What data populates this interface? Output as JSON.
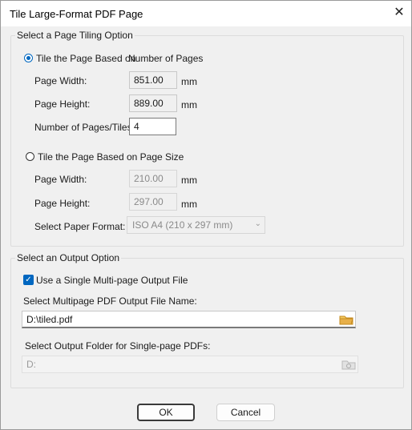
{
  "window": {
    "title": "Tile Large-Format PDF Page",
    "close_glyph": "✕"
  },
  "tiling": {
    "legend": "Select a Page Tiling Option",
    "by_pages": {
      "label": "Tile the Page Based on",
      "suffix": "Number of Pages",
      "selected": true,
      "width_label": "Page Width:",
      "width_value": "851.00",
      "width_unit": "mm",
      "height_label": "Page Height:",
      "height_value": "889.00",
      "height_unit": "mm",
      "tiles_label": "Number of Pages/Tiles:",
      "tiles_value": "4"
    },
    "by_size": {
      "label": "Tile the Page Based on Page Size",
      "selected": false,
      "width_label": "Page Width:",
      "width_value": "210.00",
      "width_unit": "mm",
      "height_label": "Page Height:",
      "height_value": "297.00",
      "height_unit": "mm",
      "format_label": "Select Paper Format:",
      "format_value": "ISO A4 (210 x 297 mm)"
    }
  },
  "output": {
    "legend": "Select an Output Option",
    "single_file": {
      "label": "Use a Single Multi-page Output File",
      "checked": true
    },
    "multipage_label": "Select Multipage PDF Output File Name:",
    "multipage_value": "D:\\tiled.pdf",
    "folder_label": "Select Output Folder for Single-page PDFs:",
    "folder_value": "D:",
    "icons": {
      "browse_file": "folder-icon",
      "browse_folder": "folder-search-icon"
    }
  },
  "buttons": {
    "ok": "OK",
    "cancel": "Cancel"
  },
  "colors": {
    "accent": "#0067c0",
    "folder": "#e8b04a"
  }
}
